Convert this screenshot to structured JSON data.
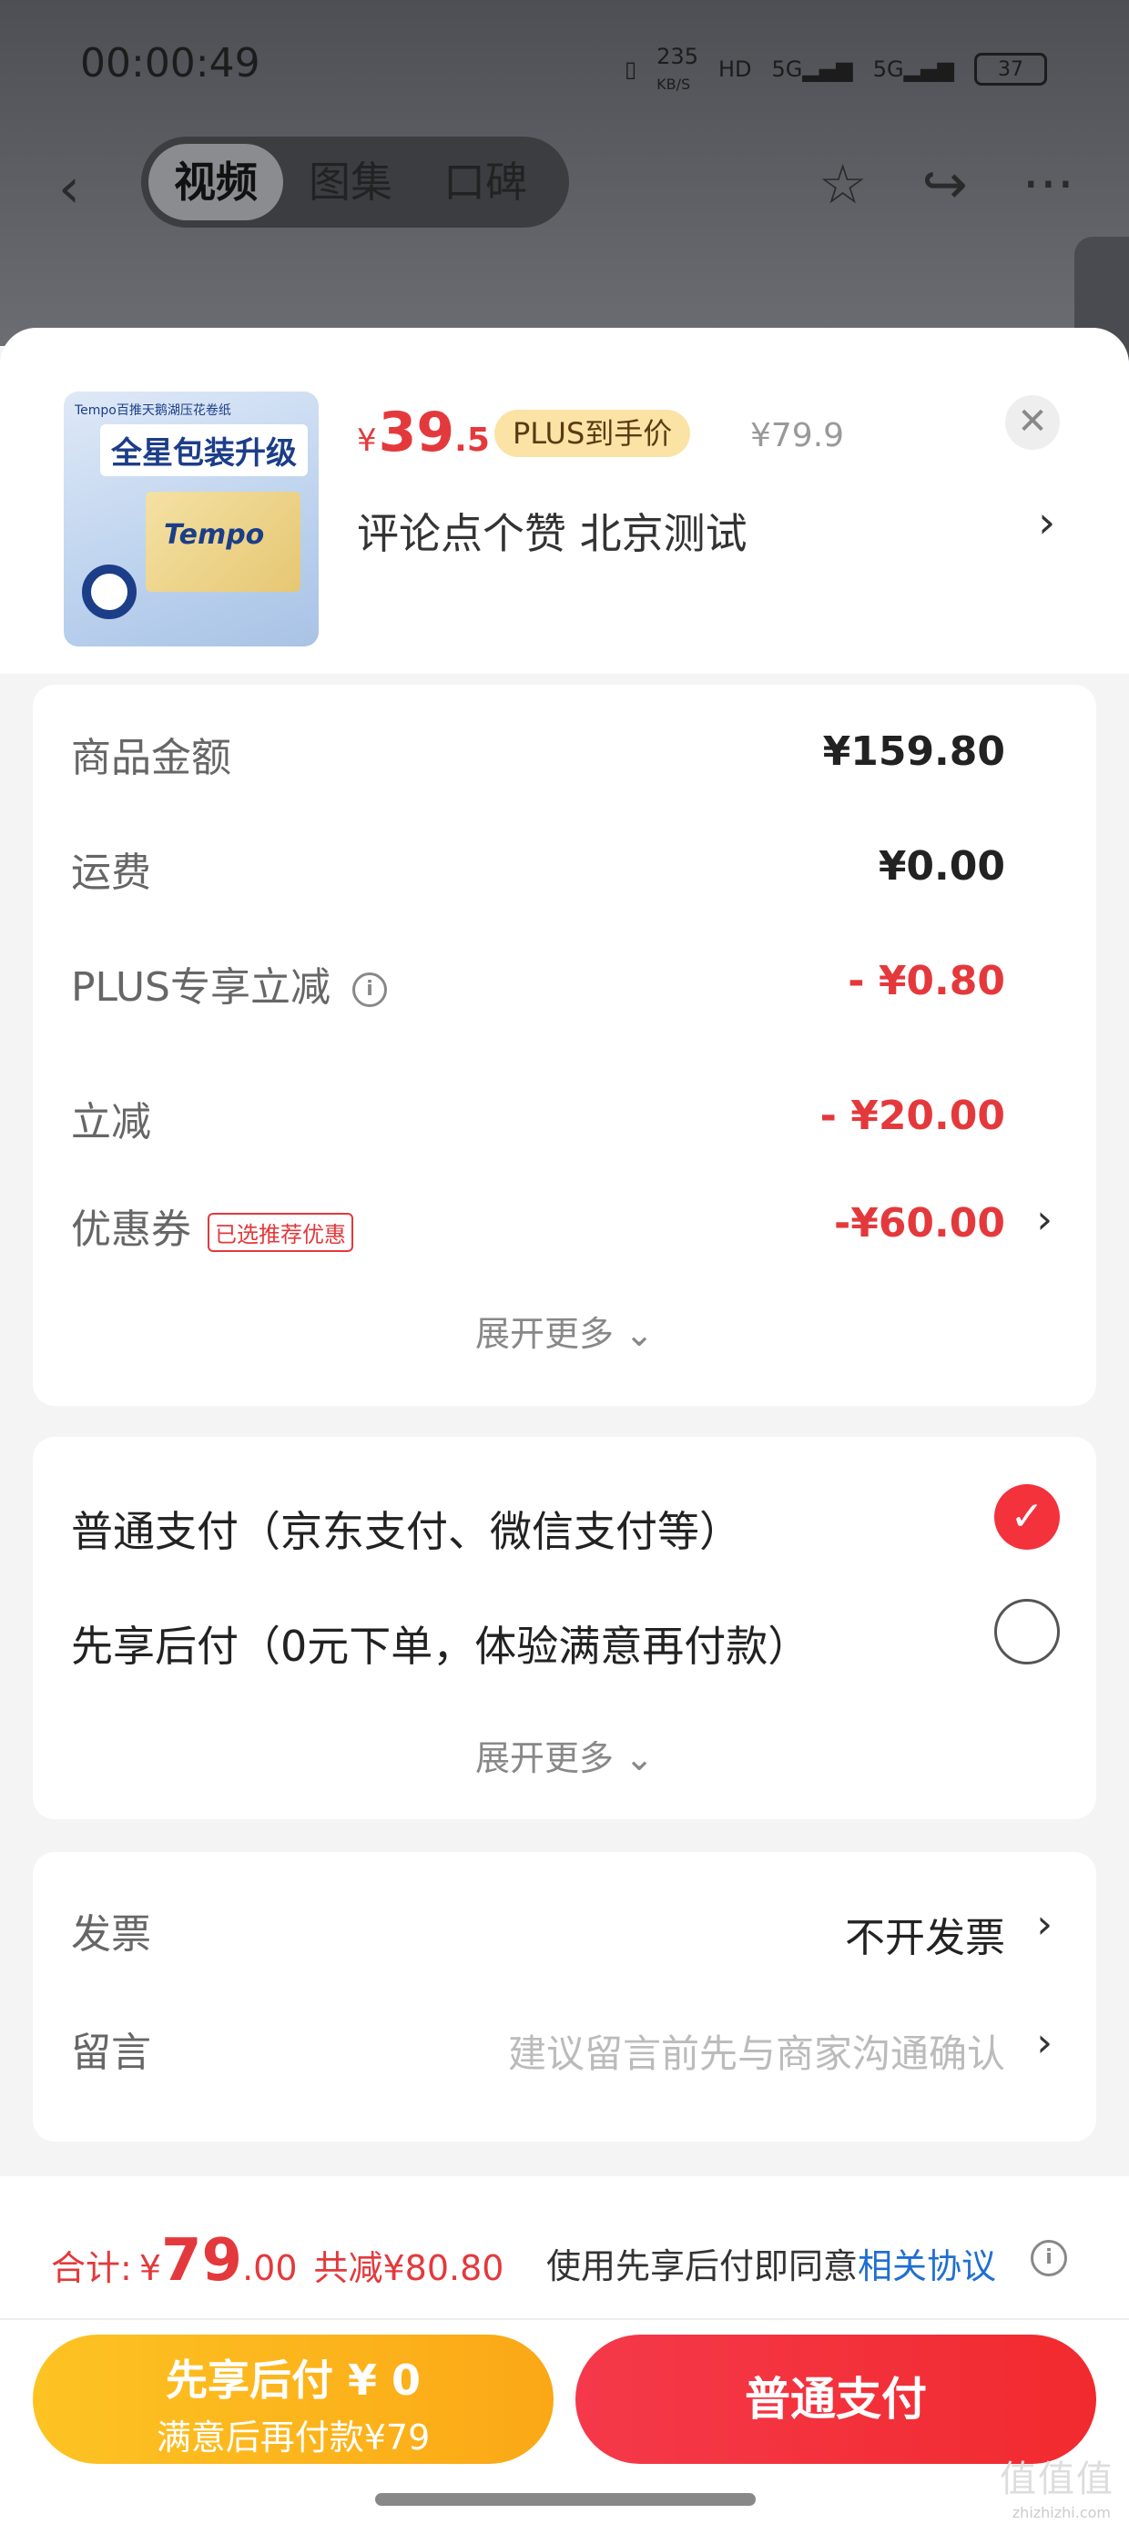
{
  "status_bar": {
    "time": "00:00:49",
    "speed": "235",
    "speed_unit": "KB/S",
    "hd": "HD",
    "net1": "5G",
    "net2": "5G",
    "battery": "37"
  },
  "nav": {
    "tabs": [
      "视频",
      "图集",
      "口碑"
    ],
    "active_tab": 0
  },
  "product": {
    "currency": "¥",
    "price_int": "39",
    "price_dec": ".5",
    "plus_badge": "PLUS到手价",
    "original_price": "¥79.9",
    "address": "评论点个赞  北京测试",
    "thumb_text": "全星包装升级",
    "thumb_small": "Tempo百推天鹅湖压花卷纸",
    "thumb_logo": "Tempo"
  },
  "summary": {
    "rows": [
      {
        "label": "商品金额",
        "value": "¥159.80"
      },
      {
        "label": "运费",
        "value": "¥0.00"
      },
      {
        "label": "PLUS专享立减",
        "value": "- ¥0.80"
      },
      {
        "label": "立减",
        "value": "- ¥20.00"
      },
      {
        "label": "优惠券",
        "value": "-¥60.00",
        "tag": "已选推荐优惠"
      }
    ],
    "more": "展开更多 ⌄"
  },
  "payment": {
    "options": [
      "普通支付（京东支付、微信支付等）",
      "先享后付（0元下单，体验满意再付款）"
    ],
    "selected": 0,
    "more": "展开更多 ⌄"
  },
  "extra": {
    "invoice_label": "发票",
    "invoice_value": "不开发票",
    "note_label": "留言",
    "note_placeholder": "建议留言前先与商家沟通确认"
  },
  "bottom": {
    "total_label": "合计:",
    "yen": "¥",
    "total_int": "79",
    "total_dec": ".00",
    "saved": "共减¥80.80",
    "agree_text": "使用先享后付即同意",
    "agree_link": "相关协议",
    "btn_later_main": "先享后付 ¥ 0",
    "btn_later_sub": "满意后再付款¥79",
    "btn_pay": "普通支付"
  },
  "watermark": {
    "main": "值值值",
    "sub": "zhizhizhi.com"
  },
  "colors": {
    "accent": "#e4393c",
    "gold": "#fdc323",
    "link": "#1f6fd0"
  }
}
